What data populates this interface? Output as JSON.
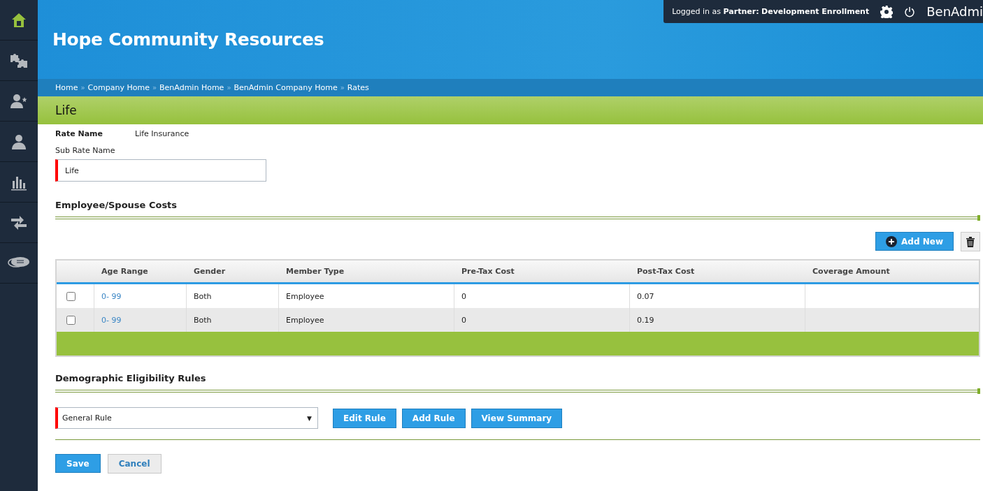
{
  "sidebar": {
    "items": [
      {
        "kind": "home",
        "selected": true
      },
      {
        "kind": "puzzle",
        "selected": false
      },
      {
        "kind": "person-star",
        "selected": false
      },
      {
        "kind": "person",
        "selected": false
      },
      {
        "kind": "chart",
        "selected": false
      },
      {
        "kind": "transfer",
        "selected": false
      },
      {
        "kind": "chat",
        "selected": false
      }
    ]
  },
  "header": {
    "title": "Hope Community Resources",
    "login": "Logged in as **Partner:**  **Development Enrollment**",
    "brand": "BenAdmi"
  },
  "breadcrumb": {
    "separator": "»",
    "items": [
      "Home",
      "Company Home",
      "BenAdmin Home",
      "BenAdmin Company Home",
      "Rates"
    ]
  },
  "page_title": "Life",
  "rate_name": {
    "label": "Rate Name",
    "value": "Life Insurance"
  },
  "sub_rate_name": {
    "label": "Sub Rate Name",
    "value": "Life",
    "required": true
  },
  "costs": {
    "title": "Employee/Spouse Costs",
    "add_button": "Add New",
    "columns": [
      "Age Range",
      "Gender",
      "Member Type",
      "Pre-Tax Cost",
      "Post-Tax Cost",
      "Coverage Amount"
    ],
    "rows": [
      {
        "checked": false,
        "cells": [
          "0- 99",
          "Both",
          "Employee",
          "0",
          "0.07",
          ""
        ]
      },
      {
        "checked": false,
        "cells": [
          "0- 99",
          "Both",
          "Employee",
          "0",
          "0.19",
          ""
        ]
      }
    ]
  },
  "rules": {
    "title": "Demographic Eligibility Rules",
    "select": {
      "value": "General Rule",
      "arrow": "▼",
      "required": true
    },
    "buttons": [
      "Edit Rule",
      "Add Rule",
      "View Summary"
    ]
  },
  "actions": {
    "save": "Save",
    "cancel": "Cancel"
  }
}
